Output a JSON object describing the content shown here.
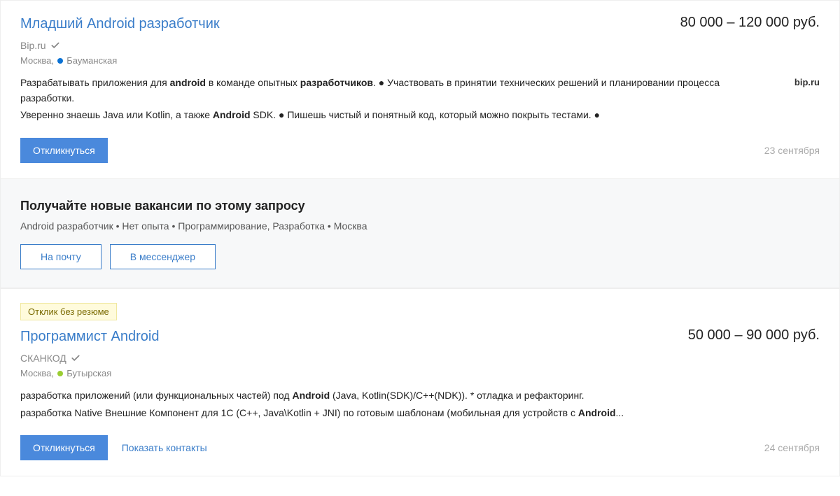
{
  "vacancies": [
    {
      "title": "Младший Android разработчик",
      "salary": "80 000 – 120 000 руб.",
      "company": "Bip.ru",
      "verified": true,
      "city": "Москва",
      "metro": "Бауманская",
      "metro_color": "#0b72d4",
      "logo_text": "bip.ru",
      "desc_line1_a": "Разрабатывать приложения для ",
      "desc_line1_b": "android",
      "desc_line1_c": " в команде опытных ",
      "desc_line1_d": "разработчиков",
      "desc_line1_e": ". ● Участвовать в принятии технических решений и планировании процесса разработки.",
      "desc_line2_a": "Уверенно знаешь Java или Kotlin, а также ",
      "desc_line2_b": "Android",
      "desc_line2_c": " SDK. ● Пишешь чистый и понятный код, который можно покрыть тестами. ●",
      "apply_label": "Откликнуться",
      "date": "23 сентября"
    },
    {
      "badge": "Отклик без резюме",
      "title": "Программист Android",
      "salary": "50 000 – 90 000 руб.",
      "company": "СКАНКОД",
      "verified": true,
      "city": "Москва",
      "metro": "Бутырская",
      "metro_color": "#9acd32",
      "desc_line1_a": "разработка приложений (или функциональных частей) под ",
      "desc_line1_b": "Android",
      "desc_line1_c": " (Java, Kotlin(SDK)/C++(NDK)). * отладка и рефакторинг.",
      "desc_line2_a": "разработка Native Внешние Компонент для 1C (C++, Java\\Kotlin + JNI) по готовым шаблонам (мобильная для устройств с ",
      "desc_line2_b": "Android",
      "desc_line2_c": "...",
      "apply_label": "Откликнуться",
      "contacts_label": "Показать контакты",
      "date": "24 сентября"
    }
  ],
  "subscribe": {
    "title": "Получайте новые вакансии по этому запросу",
    "terms": "Android разработчик • Нет опыта • Программирование, Разработка • Москва",
    "btn_email": "На почту",
    "btn_messenger": "В мессенджер"
  }
}
